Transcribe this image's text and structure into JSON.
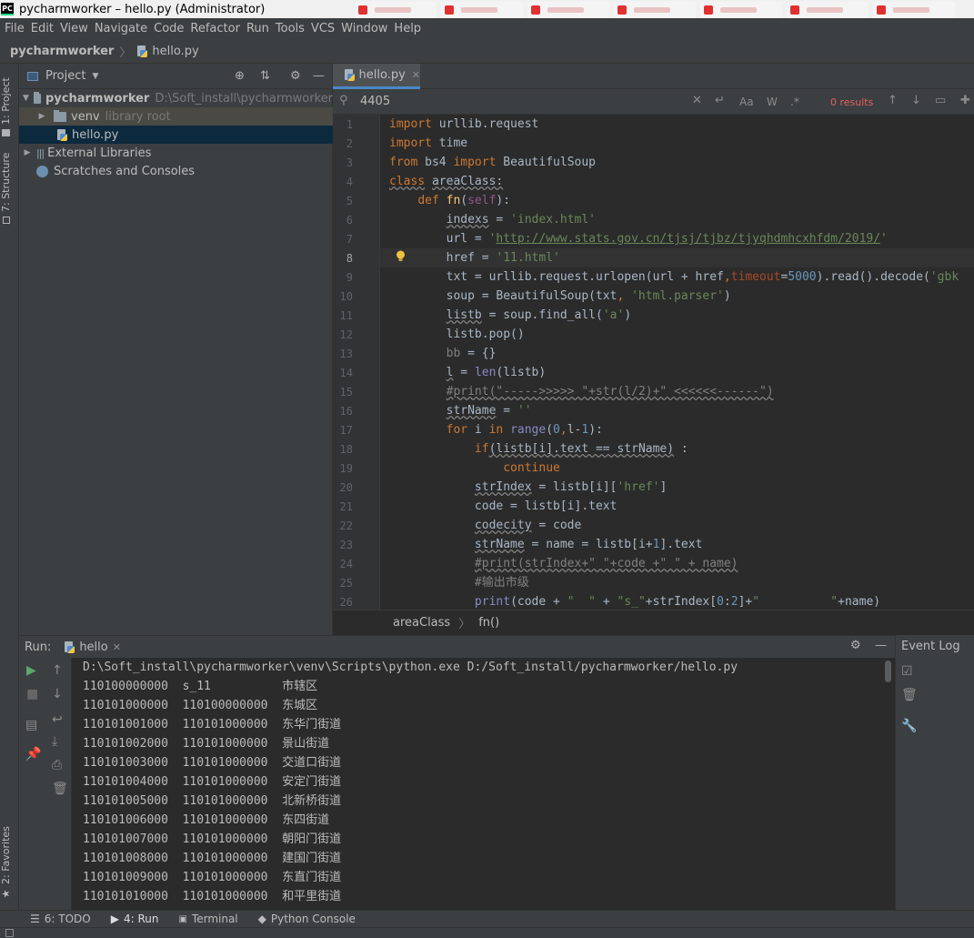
{
  "window": {
    "app_icon": "PC",
    "title": "pycharmworker – hello.py (Administrator)"
  },
  "menu": [
    "File",
    "Edit",
    "View",
    "Navigate",
    "Code",
    "Refactor",
    "Run",
    "Tools",
    "VCS",
    "Window",
    "Help"
  ],
  "navbar": {
    "project": "pycharmworker",
    "file": "hello.py"
  },
  "sidebar": {
    "tabs": [
      "1: Project",
      "7: Structure",
      "2: Favorites"
    ]
  },
  "project_panel": {
    "title": "Project",
    "tree": [
      {
        "label": "pycharmworker",
        "path": "D:\\Soft_install\\pycharmworker"
      },
      {
        "label": "venv",
        "note": "library root"
      },
      {
        "label": "hello.py"
      },
      {
        "label": "External Libraries"
      },
      {
        "label": "Scratches and Consoles"
      }
    ]
  },
  "editor": {
    "tab": "hello.py",
    "search": {
      "value": "4405",
      "results": "0 results",
      "match_case": "Aa",
      "words": "W",
      "regex": ".*"
    },
    "line_numbers": [
      "1",
      "2",
      "3",
      "4",
      "5",
      "6",
      "7",
      "8",
      "9",
      "10",
      "11",
      "12",
      "13",
      "14",
      "15",
      "16",
      "17",
      "18",
      "19",
      "20",
      "21",
      "22",
      "23",
      "24",
      "25",
      "26"
    ],
    "current_line": "8",
    "breadcrumb": [
      "areaClass",
      "fn()"
    ]
  },
  "run": {
    "label": "Run:",
    "tab": "hello",
    "output": [
      "D:\\Soft_install\\pycharmworker\\venv\\Scripts\\python.exe D:/Soft_install/pycharmworker/hello.py",
      "110100000000  s_11          市辖区",
      "110101000000  110100000000  东城区",
      "110101001000  110101000000  东华门街道",
      "110101002000  110101000000  景山街道",
      "110101003000  110101000000  交道口街道",
      "110101004000  110101000000  安定门街道",
      "110101005000  110101000000  北新桥街道",
      "110101006000  110101000000  东四街道",
      "110101007000  110101000000  朝阳门街道",
      "110101008000  110101000000  建国门街道",
      "110101009000  110101000000  东直门街道",
      "110101010000  110101000000  和平里街道"
    ]
  },
  "event_log": {
    "title": "Event Log"
  },
  "bottom_bar": [
    {
      "label": "6: TODO"
    },
    {
      "label": "4: Run"
    },
    {
      "label": "Terminal"
    },
    {
      "label": "Python Console"
    }
  ]
}
